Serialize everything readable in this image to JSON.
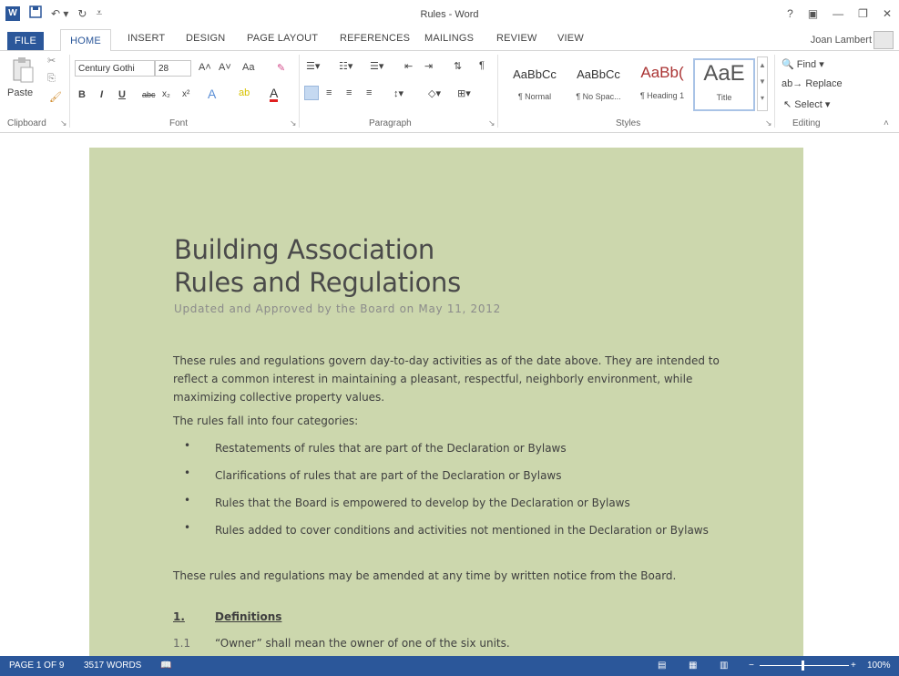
{
  "titlebar": {
    "title": "Rules - Word",
    "window_controls": [
      "?",
      "▣",
      "—",
      "❐",
      "✕"
    ],
    "qat_icons": [
      "save-icon",
      "undo-icon",
      "redo-icon",
      "customize-icon"
    ]
  },
  "tabs": [
    "FILE",
    "HOME",
    "INSERT",
    "DESIGN",
    "PAGE LAYOUT",
    "REFERENCES",
    "MAILINGS",
    "REVIEW",
    "VIEW"
  ],
  "user": "Joan Lambert",
  "ribbon": {
    "clipboard": {
      "paste": "Paste",
      "label": "Clipboard"
    },
    "font": {
      "family": "Century Gothi",
      "size": "28",
      "label": "Font",
      "bold": "B",
      "italic": "I",
      "underline": "U",
      "strike": "abc",
      "sub": "x₂",
      "sup": "x²",
      "grow": "A˄",
      "shrink": "A˅",
      "case": "Aa"
    },
    "paragraph": {
      "label": "Paragraph"
    },
    "styles": {
      "label": "Styles",
      "items": [
        {
          "sample": "AaBbCc",
          "name": "¶ Normal"
        },
        {
          "sample": "AaBbCc",
          "name": "¶ No Spac..."
        },
        {
          "sample": "AaBb(",
          "name": "¶ Heading 1"
        },
        {
          "sample": "AaE",
          "name": "Title"
        }
      ]
    },
    "editing": {
      "label": "Editing",
      "find": "Find",
      "replace": "Replace",
      "select": "Select"
    }
  },
  "document": {
    "title_line1": "Building Association",
    "title_line2": "Rules and Regulations",
    "subtitle": "Updated and Approved by the Board on May 11, 2012",
    "intro": "These rules and regulations govern day-to-day activities as of the date above. They are intended to reflect a common interest in maintaining a pleasant, respectful, neighborly environment, while maximizing collective property values.",
    "categories_intro": "The rules fall into four categories:",
    "bullets": [
      "Restatements of rules that are part of the Declaration or Bylaws",
      "Clarifications of rules that are part of the Declaration or Bylaws",
      "Rules that the Board is empowered to develop by the Declaration or Bylaws",
      "Rules added to cover conditions and activities not mentioned in the Declaration or Bylaws"
    ],
    "amend": "These rules and regulations may be amended at any time by written notice from the Board.",
    "section_num": "1.",
    "section_title": "Definitions",
    "sub_num": "1.1",
    "sub_text": "“Owner” shall mean the owner of one of the six units."
  },
  "status": {
    "page": "PAGE 1 OF 9",
    "words": "3517 WORDS",
    "zoom": "100%"
  }
}
